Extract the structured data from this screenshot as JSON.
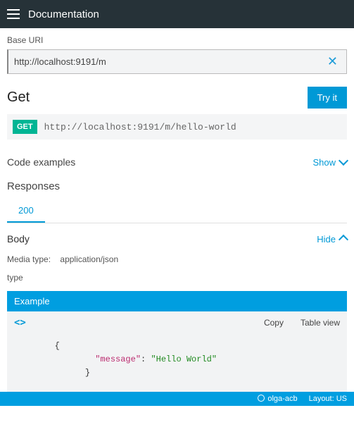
{
  "topbar": {
    "title": "Documentation"
  },
  "baseuri": {
    "label": "Base URI",
    "value": "http://localhost:9191/m"
  },
  "endpoint": {
    "title": "Get",
    "tryit": "Try it",
    "method": "GET",
    "url": "http://localhost:9191/m/hello-world"
  },
  "codeExamples": {
    "label": "Code examples",
    "toggle": "Show"
  },
  "responses": {
    "title": "Responses",
    "tab": "200",
    "body": {
      "label": "Body",
      "toggle": "Hide",
      "media_label": "Media type:",
      "media_value": "application/json",
      "type_label": "type"
    },
    "example": {
      "header": "Example",
      "copy": "Copy",
      "table": "Table view",
      "json_key": "\"message\"",
      "json_val": "\"Hello World\""
    }
  },
  "footer": {
    "user": "olga-acb",
    "layout": "Layout: US"
  }
}
